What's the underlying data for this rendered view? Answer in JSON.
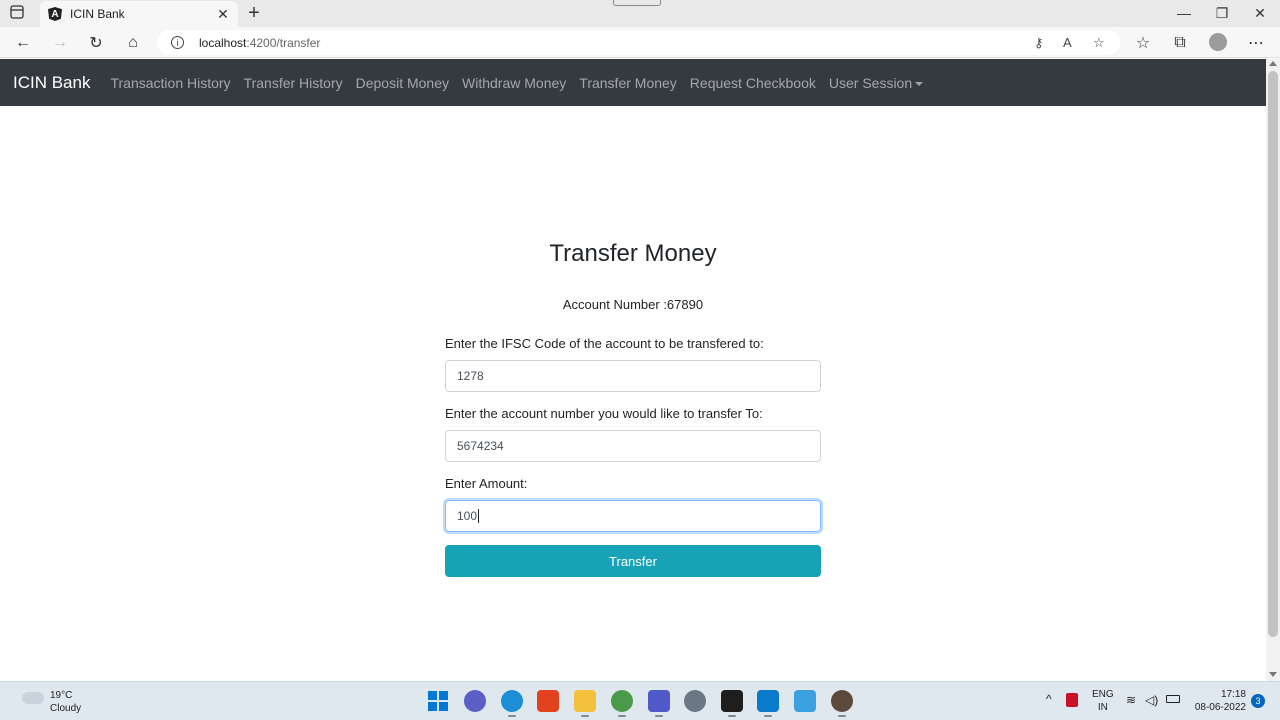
{
  "browser": {
    "tab_title": "ICIN Bank",
    "url_host": "localhost",
    "url_path": ":4200/transfer"
  },
  "navbar": {
    "brand": "ICIN Bank",
    "links": [
      "Transaction History",
      "Transfer History",
      "Deposit Money",
      "Withdraw Money",
      "Transfer Money",
      "Request Checkbook",
      "User Session"
    ]
  },
  "page": {
    "title": "Transfer Money",
    "account_number": "Account Number :67890"
  },
  "form": {
    "ifsc_label": "Enter the IFSC Code of the account to be transfered to:",
    "ifsc_value": "1278",
    "account_label": "Enter the account number you would like to transfer To:",
    "account_value": "5674234",
    "amount_label": "Enter Amount:",
    "amount_value": "100",
    "submit_label": "Transfer"
  },
  "taskbar": {
    "temperature": "19°C",
    "weather": "Cloudy",
    "lang": "ENG",
    "region": "IN",
    "time": "17:18",
    "date": "08-06-2022",
    "notifications": "3"
  },
  "colors": {
    "navbar_bg": "#343a40",
    "button_bg": "#17a2b8"
  }
}
